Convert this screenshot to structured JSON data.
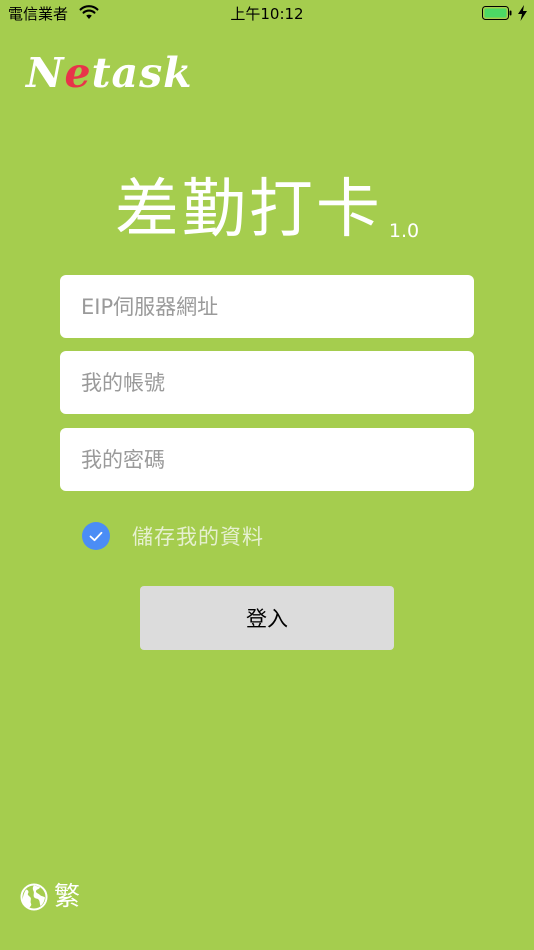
{
  "status_bar": {
    "carrier": "電信業者",
    "time": "上午10:12",
    "wifi_icon": "wifi-icon",
    "battery_icon": "battery-icon",
    "charging_icon": "charging-bolt-icon"
  },
  "brand": {
    "logo_prefix": "N",
    "logo_highlight": "e",
    "logo_suffix": "task",
    "highlight_color": "#e8334a"
  },
  "app": {
    "title": "差勤打卡",
    "version": "1.0"
  },
  "form": {
    "server_placeholder": "EIP伺服器網址",
    "account_placeholder": "我的帳號",
    "password_placeholder": "我的密碼",
    "remember_label": "儲存我的資料",
    "remember_checked": true,
    "login_label": "登入"
  },
  "language": {
    "icon": "globe-icon",
    "label": "繁"
  },
  "colors": {
    "background": "#a5cd4e",
    "checkbox": "#4b8df5",
    "button": "#dcdcdc"
  }
}
